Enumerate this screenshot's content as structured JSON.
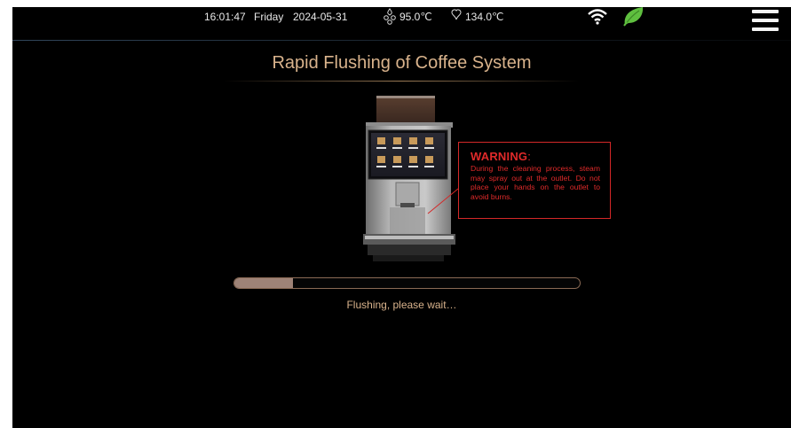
{
  "status_bar": {
    "time": "16:01:47",
    "day": "Friday",
    "date": "2024-05-31",
    "boiler_temp": "95.0℃",
    "steam_temp": "134.0℃",
    "icons": [
      "boiler-icon",
      "steam-icon",
      "wifi-icon",
      "eco-leaf-icon",
      "menu-icon"
    ]
  },
  "title": "Rapid Flushing of Coffee System",
  "warning": {
    "title": "WARNING",
    "text": "During the cleaning process, steam may spray out at the outlet. Do not place your hands on the outlet to avoid burns."
  },
  "progress": {
    "value": 0.17
  },
  "status_text": "Flushing, please wait…",
  "colors": {
    "accent": "#d9b38c",
    "warning": "#e02a2a",
    "progress_fill": "#9e8377",
    "background": "#000000"
  }
}
